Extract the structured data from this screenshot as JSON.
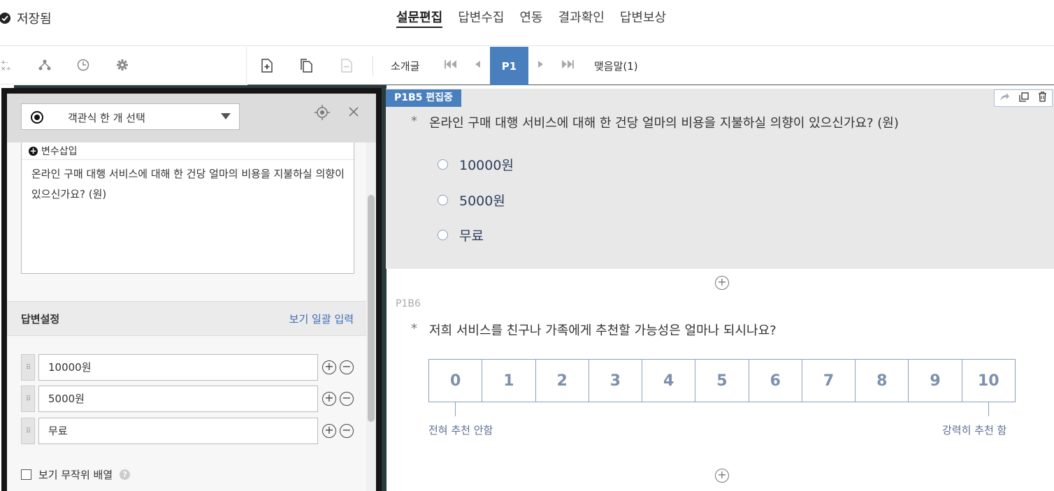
{
  "top": {
    "saved_label": "저장됨",
    "tabs": [
      {
        "label": "설문편집",
        "active": true
      },
      {
        "label": "답변수집",
        "active": false
      },
      {
        "label": "연동",
        "active": false
      },
      {
        "label": "결과확인",
        "active": false
      },
      {
        "label": "답변보상",
        "active": false
      }
    ]
  },
  "left_tools": [
    "calculator-icon",
    "branch-icon",
    "clock-icon",
    "gear-icon"
  ],
  "page_toolbar": {
    "intro_label": "소개글",
    "current_page": "P1",
    "closing_label": "맺음말(1)"
  },
  "editor": {
    "question_type": "객관식 한 개 선택",
    "insert_variable": "변수삽입",
    "question_text": "온라인 구매 대행 서비스에 대해 한 건당 얼마의 비용을 지불하실 의향이 있으신가요? (원)",
    "answer_settings_title": "답변설정",
    "bulk_input_link": "보기 일괄 입력",
    "options": [
      "10000원",
      "5000원",
      "무료"
    ],
    "random_order_label": "보기 무작위 배열",
    "random_order_checked": false
  },
  "q1": {
    "badge": "P1B5 편집중",
    "star": "*",
    "title": "온라인 구매 대행 서비스에 대해 한 건당 얼마의 비용을 지불하실 의향이 있으신가요? (원)",
    "choices": [
      "10000원",
      "5000원",
      "무료"
    ]
  },
  "q2": {
    "id": "P1B6",
    "star": "*",
    "title": "저희 서비스를 친구나 가족에게 추천할 가능성은 얼마나 되시나요?",
    "scale": [
      "0",
      "1",
      "2",
      "3",
      "4",
      "5",
      "6",
      "7",
      "8",
      "9",
      "10"
    ],
    "low_label": "전혀 추천 안함",
    "high_label": "강력히 추천 함"
  },
  "colors": {
    "accent": "#4a7fbd",
    "scale_text": "#7d90ad",
    "link": "#3e6db5"
  }
}
